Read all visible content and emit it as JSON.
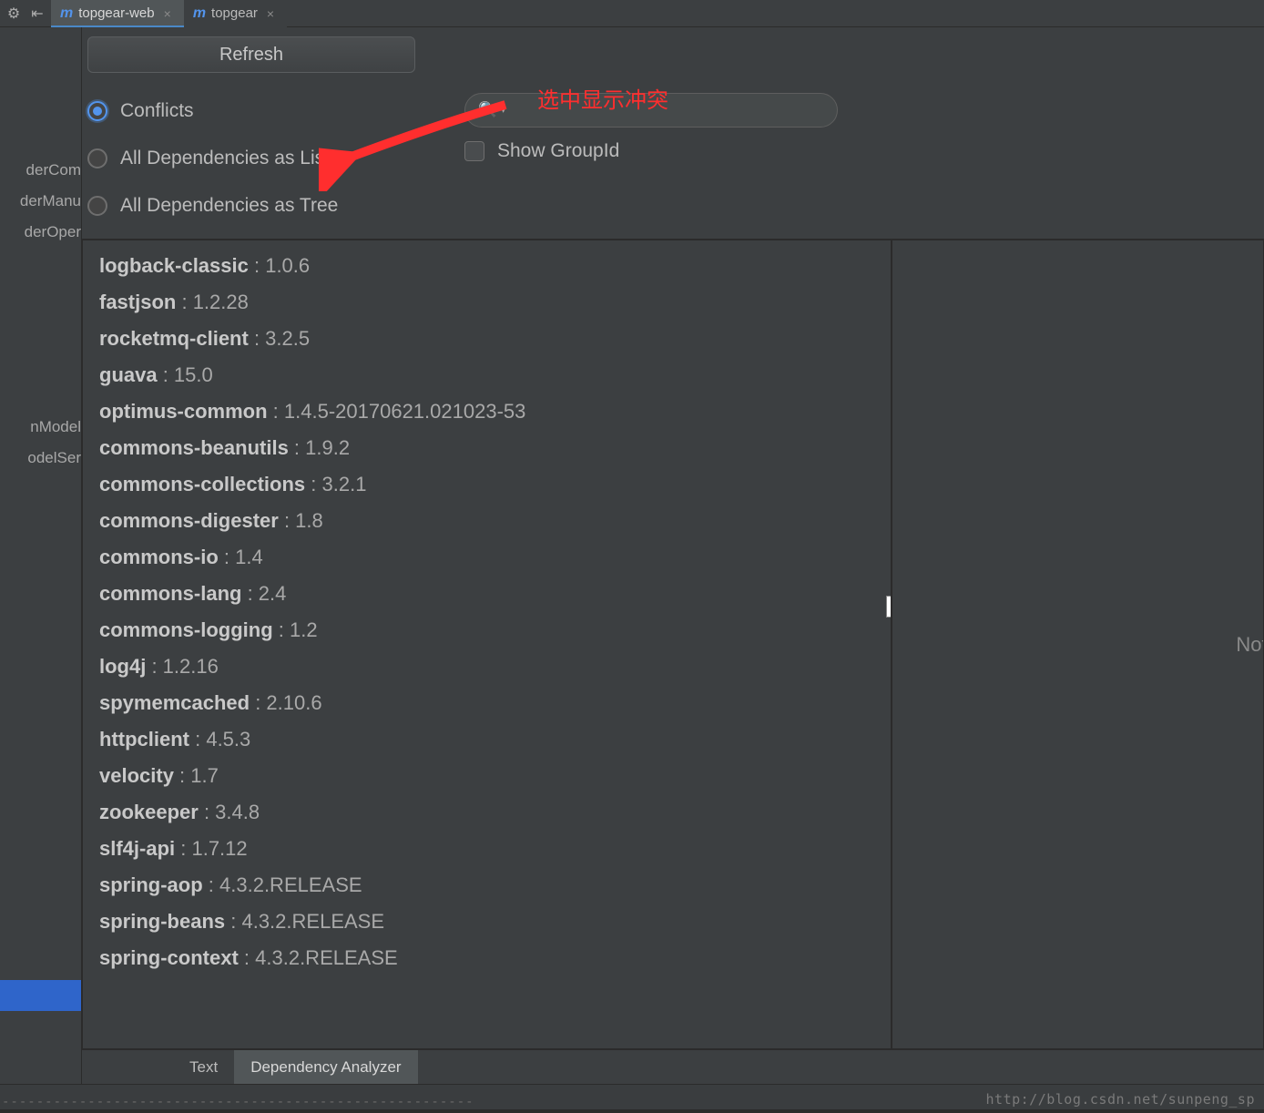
{
  "toolbar": {
    "gear": "⚙",
    "arrow": "⇤"
  },
  "tabs": [
    {
      "label": "topgear-web",
      "active": true
    },
    {
      "label": "topgear",
      "active": false
    }
  ],
  "refresh_label": "Refresh",
  "radios": {
    "conflicts": "Conflicts",
    "list": "All Dependencies as List",
    "tree": "All Dependencies as Tree"
  },
  "checkbox": {
    "show_groupid": "Show GroupId"
  },
  "search": {
    "placeholder": ""
  },
  "annotation": "选中显示冲突",
  "left_items_top": [
    "derCom",
    "derManu",
    "derOper"
  ],
  "left_items_bot": [
    "nModel",
    "odelSer"
  ],
  "dependencies": [
    {
      "name": "logback-classic",
      "ver": "1.0.6"
    },
    {
      "name": "fastjson",
      "ver": "1.2.28"
    },
    {
      "name": "rocketmq-client",
      "ver": "3.2.5"
    },
    {
      "name": "guava",
      "ver": "15.0"
    },
    {
      "name": "optimus-common",
      "ver": "1.4.5-20170621.021023-53"
    },
    {
      "name": "commons-beanutils",
      "ver": "1.9.2"
    },
    {
      "name": "commons-collections",
      "ver": "3.2.1"
    },
    {
      "name": "commons-digester",
      "ver": "1.8"
    },
    {
      "name": "commons-io",
      "ver": "1.4"
    },
    {
      "name": "commons-lang",
      "ver": "2.4"
    },
    {
      "name": "commons-logging",
      "ver": "1.2"
    },
    {
      "name": "log4j",
      "ver": "1.2.16"
    },
    {
      "name": "spymemcached",
      "ver": "2.10.6"
    },
    {
      "name": "httpclient",
      "ver": "4.5.3"
    },
    {
      "name": "velocity",
      "ver": "1.7"
    },
    {
      "name": "zookeeper",
      "ver": "3.4.8"
    },
    {
      "name": "slf4j-api",
      "ver": "1.7.12"
    },
    {
      "name": "spring-aop",
      "ver": "4.3.2.RELEASE"
    },
    {
      "name": "spring-beans",
      "ver": "4.3.2.RELEASE"
    },
    {
      "name": "spring-context",
      "ver": "4.3.2.RELEASE"
    }
  ],
  "right_placeholder": "Nothin",
  "bottom_tabs": {
    "text": "Text",
    "analyzer": "Dependency Analyzer"
  },
  "watermark": "http://blog.csdn.net/sunpeng_sp",
  "dashes": "------------------------------------------------------------"
}
